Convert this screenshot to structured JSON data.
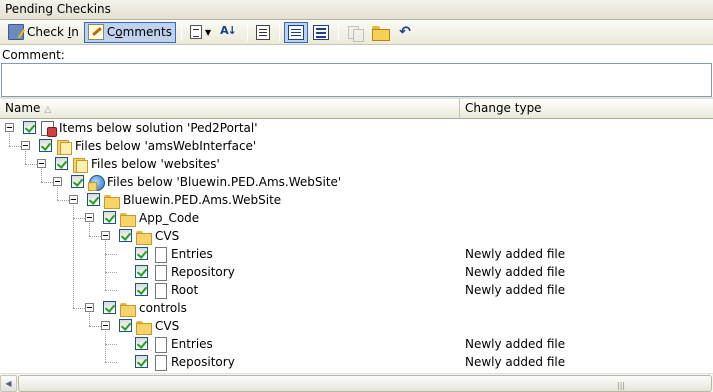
{
  "window": {
    "title": "Pending Checkins"
  },
  "toolbar": {
    "checkin_label": "Check In",
    "checkin_accel_pre": "Check ",
    "checkin_accel": "I",
    "checkin_accel_post": "n",
    "comments_label_pre": "C",
    "comments_accel": "o",
    "comments_label_post": "mments"
  },
  "comment": {
    "label": "Comment:",
    "value": ""
  },
  "columns": {
    "name": "Name",
    "change": "Change type"
  },
  "tree": [
    {
      "label": "Items below solution 'Ped2Portal'",
      "icon": "solution-icon",
      "change": ""
    },
    {
      "label": "Files below 'amsWebInterface'",
      "icon": "open-folder-icon",
      "change": ""
    },
    {
      "label": "Files below 'websites'",
      "icon": "open-folder-icon",
      "change": ""
    },
    {
      "label": "Files below 'Bluewin.PED.Ams.WebSite'",
      "icon": "web-project-icon",
      "change": ""
    },
    {
      "label": "Bluewin.PED.Ams.WebSite",
      "icon": "folder-icon",
      "change": ""
    },
    {
      "label": "App_Code",
      "icon": "folder-icon",
      "change": ""
    },
    {
      "label": "CVS",
      "icon": "folder-icon",
      "change": ""
    },
    {
      "label": "Entries",
      "icon": "file-icon",
      "change": "Newly added file"
    },
    {
      "label": "Repository",
      "icon": "file-icon",
      "change": "Newly added file"
    },
    {
      "label": "Root",
      "icon": "file-icon",
      "change": "Newly added file"
    },
    {
      "label": "controls",
      "icon": "folder-icon",
      "change": ""
    },
    {
      "label": "CVS",
      "icon": "folder-icon",
      "change": ""
    },
    {
      "label": "Entries",
      "icon": "file-icon",
      "change": "Newly added file"
    },
    {
      "label": "Repository",
      "icon": "file-icon",
      "change": "Newly added file"
    }
  ]
}
